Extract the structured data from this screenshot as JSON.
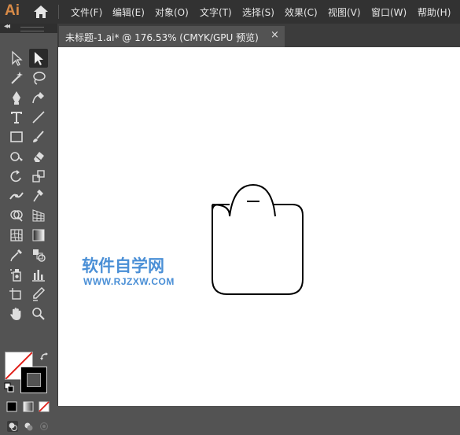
{
  "app": {
    "logo_text": "Ai"
  },
  "menu": {
    "items": [
      "文件(F)",
      "编辑(E)",
      "对象(O)",
      "文字(T)",
      "选择(S)",
      "效果(C)",
      "视图(V)",
      "窗口(W)",
      "帮助(H)"
    ]
  },
  "document_tab": {
    "title": "未标题-1.ai* @ 176.53% (CMYK/GPU 预览)",
    "close_glyph": "×"
  },
  "panel": {
    "collapse_glyph": "◂◂"
  },
  "watermark": {
    "cn": "软件自学网",
    "url": "WWW.RJZXW.COM",
    "color": "#4a8fd6"
  },
  "colors": {
    "menubar": "#323232",
    "panel": "#535353",
    "canvas": "#ffffff",
    "app_accent": "#d98b47"
  },
  "tools": [
    "selection-tool",
    "direct-selection-tool",
    "magic-wand-tool",
    "lasso-tool",
    "pen-tool",
    "curvature-tool",
    "type-tool",
    "line-segment-tool",
    "rectangle-tool",
    "paintbrush-tool",
    "shaper-tool",
    "eraser-tool",
    "rotate-tool",
    "scale-tool",
    "width-tool",
    "puppet-warp-tool",
    "shape-builder-tool",
    "perspective-grid-tool",
    "mesh-tool",
    "gradient-tool",
    "eyedropper-tool",
    "blend-tool",
    "symbol-sprayer-tool",
    "column-graph-tool",
    "artboard-tool",
    "slice-tool",
    "hand-tool",
    "zoom-tool"
  ]
}
